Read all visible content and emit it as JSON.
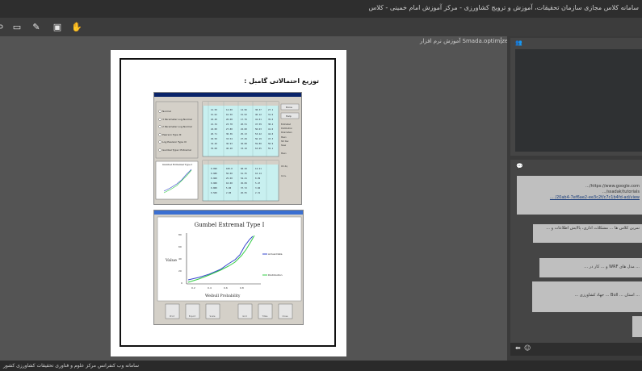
{
  "window": {
    "title": "سامانه کلاس مجازی سازمان تحقیقات، آموزش و ترویج کشاورزی - مرکز آموزش امام خمینی - کلاس"
  },
  "document": {
    "label": "آموزش نرم افزار Smada.optimized",
    "page_heading": "توزیع احتمالاتی گامبل :",
    "screenshot_table_header": [
      "ExCal",
      "EnCel",
      "Vc Incur",
      "Inv Blecl",
      "Rnk Hal"
    ],
    "screenshot_options": [
      "Normal",
      "3 Parameter Log-Normal",
      "2 Parameter Log-Normal",
      "Pearson Type III",
      "Log Pearson Type III",
      "Gumbel Type I Extremal"
    ],
    "screenshot_buttons": [
      "Done",
      "Help"
    ],
    "plot": {
      "title": "Gumbel Extremal Type I",
      "ylabel": "Value",
      "xlabel": "Weibull Probability",
      "legend": [
        "Actual Data",
        "Distribution"
      ],
      "buttons": [
        "Print",
        "Export",
        "Scale",
        "Grid",
        "Titles",
        "Close"
      ]
    }
  },
  "chat": {
    "messages": [
      "https://www.google.com/...",
      "ssadak/tutorials/...",
      "20ab4-7ef6ae2-ee3c2f/c7c1b4fd-ad/view/ ...",
      "تمرین کلاس ها ... مشکلات اداری، پالایش اطلاعات و ...",
      "... مدل های WRF و ... کار در ...",
      "... استان ... Bull ... جهاد کشاورزی ..."
    ]
  },
  "statusbar": {
    "text": "سامانه وب کنفرانس مرکز علوم و فناوری تحقیقات کشاورزی کشور"
  },
  "colors": {
    "plot_actual": "#3344cc",
    "plot_distribution": "#33cc44"
  }
}
